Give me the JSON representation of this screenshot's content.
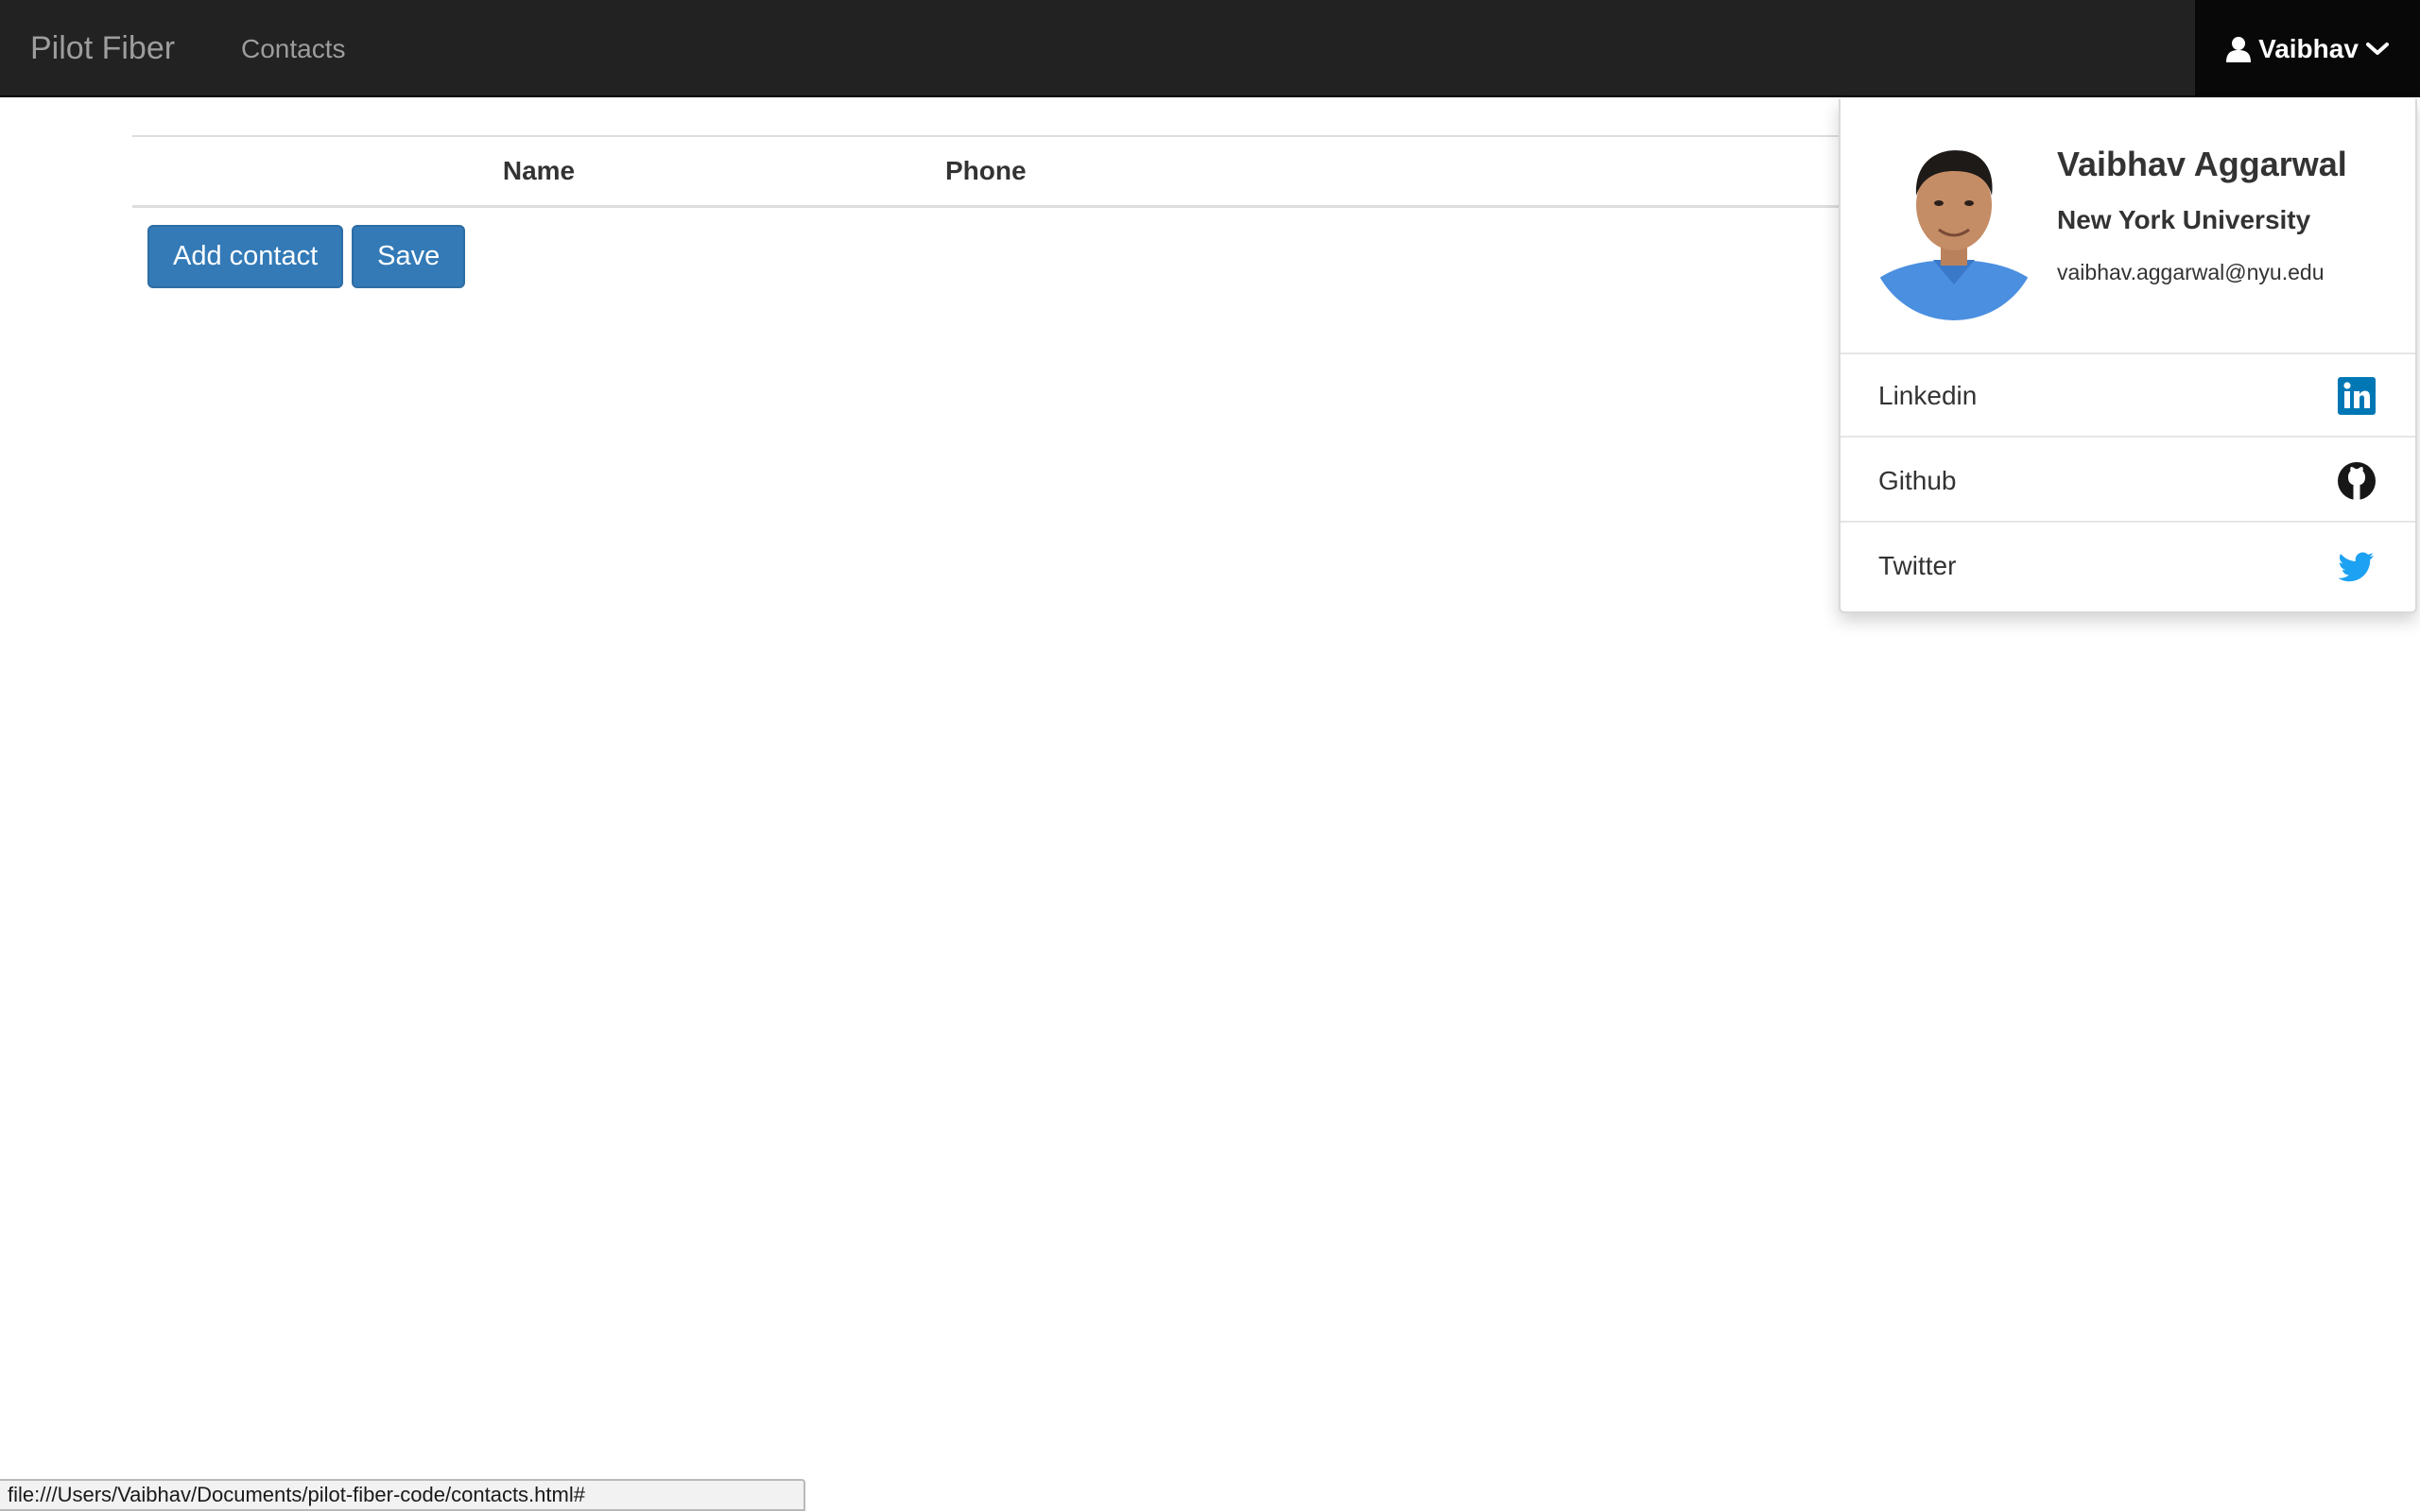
{
  "navbar": {
    "brand": "Pilot Fiber",
    "nav_link": "Contacts",
    "user_label": "Vaibhav",
    "bg_color": "#222222"
  },
  "table": {
    "headers": [
      "Name",
      "Phone"
    ]
  },
  "actions": {
    "add_contact_label": "Add contact",
    "save_label": "Save",
    "button_color": "#337ab7"
  },
  "profile": {
    "name": "Vaibhav Aggarwal",
    "organization": "New York University",
    "email": "vaibhav.aggarwal@nyu.edu",
    "social": [
      {
        "label": "Linkedin",
        "icon": "linkedin-icon",
        "color": "#0077b5"
      },
      {
        "label": "Github",
        "icon": "github-icon",
        "color": "#181717"
      },
      {
        "label": "Twitter",
        "icon": "twitter-icon",
        "color": "#1da1f2"
      }
    ]
  },
  "status_bar": {
    "url": "file:///Users/Vaibhav/Documents/pilot-fiber-code/contacts.html#"
  }
}
